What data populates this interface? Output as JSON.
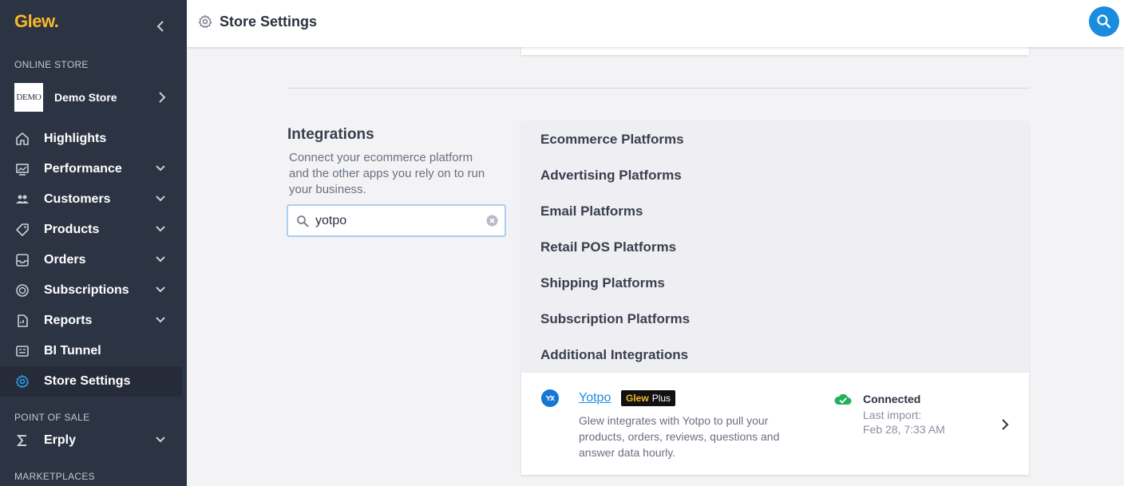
{
  "brand": {
    "name": "Glew",
    "dot": "."
  },
  "sidebar": {
    "online_store_label": "ONLINE STORE",
    "store": {
      "logo_text": "DEMO",
      "name": "Demo Store"
    },
    "items": [
      {
        "label": "Highlights",
        "icon": "home-icon"
      },
      {
        "label": "Performance",
        "icon": "chart-icon"
      },
      {
        "label": "Customers",
        "icon": "users-icon"
      },
      {
        "label": "Products",
        "icon": "tag-icon"
      },
      {
        "label": "Orders",
        "icon": "inbox-icon"
      },
      {
        "label": "Subscriptions",
        "icon": "subscriptions-icon"
      },
      {
        "label": "Reports",
        "icon": "report-icon"
      },
      {
        "label": "BI Tunnel",
        "icon": "bi-tunnel-icon"
      },
      {
        "label": "Store Settings",
        "icon": "gear-icon"
      }
    ],
    "pos_label": "POINT OF SALE",
    "pos_item": {
      "label": "Erply",
      "icon": "sigma-icon"
    },
    "marketplaces_label": "MARKETPLACES"
  },
  "header": {
    "title": "Store Settings"
  },
  "integrations": {
    "title": "Integrations",
    "description": "Connect your ecommerce platform and the other apps you rely on to run your business.",
    "search_value": "yotpo",
    "categories": [
      "Ecommerce Platforms",
      "Advertising Platforms",
      "Email Platforms",
      "Retail POS Platforms",
      "Shipping Platforms",
      "Subscription Platforms",
      "Additional Integrations"
    ],
    "result": {
      "name": "Yotpo",
      "badge_brand": "Glew",
      "badge_tier": "Plus",
      "description": "Glew integrates with Yotpo to pull your products, orders, reviews, questions and answer data hourly.",
      "status": "Connected",
      "last_import_label": "Last import:",
      "last_import_value": "Feb 28, 7:33 AM"
    }
  },
  "colors": {
    "sidebar_bg": "#2c3343",
    "brand": "#f7b928",
    "accent": "#1a8ce0",
    "connected": "#21b15b"
  }
}
